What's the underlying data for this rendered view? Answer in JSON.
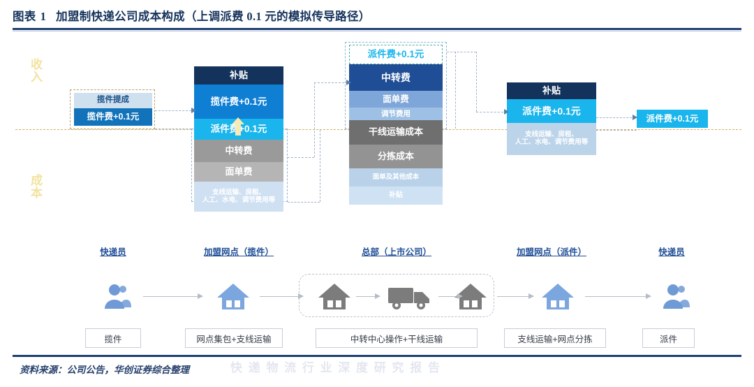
{
  "header": {
    "exhibit_label": "图表",
    "exhibit_number": "1",
    "title": "加盟制快递公司成本构成（上调派费 0.1 元的模拟传导路径）"
  },
  "axis_labels": {
    "income": "收\n入",
    "cost": "成\n本"
  },
  "columns": [
    {
      "id": "courier-pickup",
      "node_label": "快递员",
      "cells": [
        {
          "text": "揽件提成",
          "color": "#cfe0ef",
          "text_color": "#1a4f86"
        },
        {
          "text": "揽件费+0.1元",
          "color": "#1273ba",
          "text_color": "#ffffff"
        }
      ]
    },
    {
      "id": "outlet-pickup",
      "node_label": "加盟网点（揽件）",
      "cells": [
        {
          "text": "补贴",
          "color": "#14335c",
          "text_color": "#ffffff"
        },
        {
          "text": "揽件费+0.1元",
          "color": "#0f7fd4",
          "text_color": "#ffffff"
        },
        {
          "text": "派件费+0.1元",
          "color": "#19b5ec",
          "text_color": "#ffffff"
        },
        {
          "text": "中转费",
          "color": "#9a9a9a",
          "text_color": "#ffffff"
        },
        {
          "text": "面单费",
          "color": "#b5b5b5",
          "text_color": "#ffffff"
        },
        {
          "text": "支线运输、房租、\n人工、水电、调节费用等",
          "color": "#cfe0f2",
          "text_color": "#ffffff"
        }
      ]
    },
    {
      "id": "headquarters",
      "node_label": "总部（上市公司）",
      "cells": [
        {
          "text": "派件费+0.1元",
          "color": "#ffffff",
          "text_color": "#19b5ec"
        },
        {
          "text": "中转费",
          "color": "#1f4e96",
          "text_color": "#ffffff"
        },
        {
          "text": "面单费",
          "color": "#7fa6d9",
          "text_color": "#ffffff"
        },
        {
          "text": "调节费用",
          "color": "#9dc0e4",
          "text_color": "#ffffff"
        },
        {
          "text": "干线运输成本",
          "color": "#6f6f6f",
          "text_color": "#ffffff"
        },
        {
          "text": "分拣成本",
          "color": "#939393",
          "text_color": "#ffffff"
        },
        {
          "text": "面单及其他成本",
          "color": "#b9d2ea",
          "text_color": "#ffffff"
        },
        {
          "text": "补贴",
          "color": "#cfe2f4",
          "text_color": "#ffffff"
        }
      ]
    },
    {
      "id": "outlet-delivery",
      "node_label": "加盟网点（派件）",
      "cells": [
        {
          "text": "补贴",
          "color": "#14335c",
          "text_color": "#ffffff"
        },
        {
          "text": "派件费+0.1元",
          "color": "#19b5ec",
          "text_color": "#ffffff"
        },
        {
          "text": "支线运输、房租、\n人工、水电、调节费用等",
          "color": "#bcd4ea",
          "text_color": "#ffffff"
        }
      ]
    },
    {
      "id": "courier-delivery",
      "node_label": "快递员",
      "cells": [
        {
          "text": "派件费+0.1元",
          "color": "#19b5ec",
          "text_color": "#ffffff"
        }
      ]
    }
  ],
  "process": {
    "icons": [
      {
        "name": "person-icon",
        "color": "#6f9ad6"
      },
      {
        "name": "house-icon",
        "color": "#7ba6de"
      },
      {
        "name": "house-icon",
        "color": "#7c7c7c"
      },
      {
        "name": "truck-icon",
        "color": "#7c7c7c"
      },
      {
        "name": "house-icon",
        "color": "#7c7c7c"
      },
      {
        "name": "house-icon",
        "color": "#7ba6de"
      },
      {
        "name": "person-icon",
        "color": "#6f9ad6"
      }
    ],
    "steps": [
      "揽件",
      "网点集包+支线运输",
      "中转中心操作+干线运输",
      "支线运输+网点分拣",
      "派件"
    ]
  },
  "footer": {
    "source": "资料来源：公司公告，华创证券综合整理",
    "watermark": "快 递 物 流 行 业 深 度 研 究 报 告"
  },
  "colors": {
    "brand_navy": "#14335c",
    "accent_cyan": "#19b5ec",
    "accent_blue": "#1273ba",
    "highlight_yellow": "#f2e3a0",
    "divider_gold": "#c9a24a"
  }
}
